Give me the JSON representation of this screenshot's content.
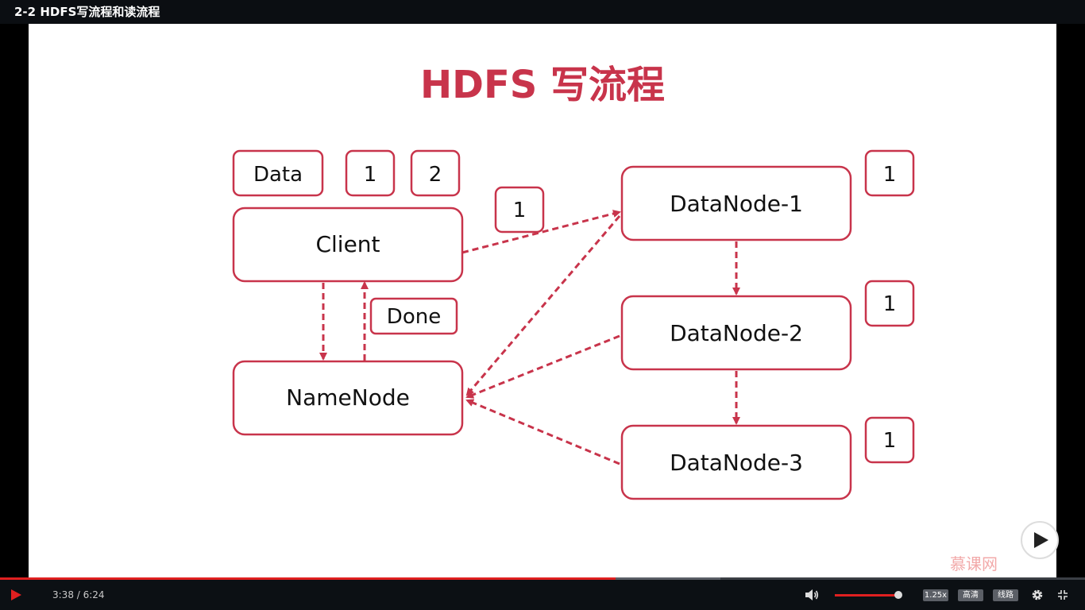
{
  "window": {
    "title": "2-2 HDFS写流程和读流程"
  },
  "slide": {
    "title": "HDFS 写流程",
    "nodes": {
      "client": "Client",
      "namenode": "NameNode",
      "datanode1": "DataNode-1",
      "datanode2": "DataNode-2",
      "datanode3": "DataNode-3"
    },
    "tags": {
      "data": "Data",
      "block1": "1",
      "block2": "2",
      "sending": "1",
      "done": "Done",
      "dn1_block": "1",
      "dn2_block": "1",
      "dn3_block": "1"
    },
    "watermark": "慕课网"
  },
  "player": {
    "time": "3:38 / 6:24",
    "progress_fraction": 0.567,
    "buffer_fraction": 0.664,
    "volume_fraction": 1.0,
    "speed": "1.25x",
    "quality": "高清",
    "line": "线路"
  },
  "colors": {
    "accent": "#c8344b",
    "progress": "#e02020"
  },
  "icons": {
    "play": "play-icon",
    "volume": "volume-icon",
    "settings": "gear-icon",
    "exit_fullscreen": "exit-fullscreen-icon",
    "overlay_play": "play-overlay-icon"
  }
}
